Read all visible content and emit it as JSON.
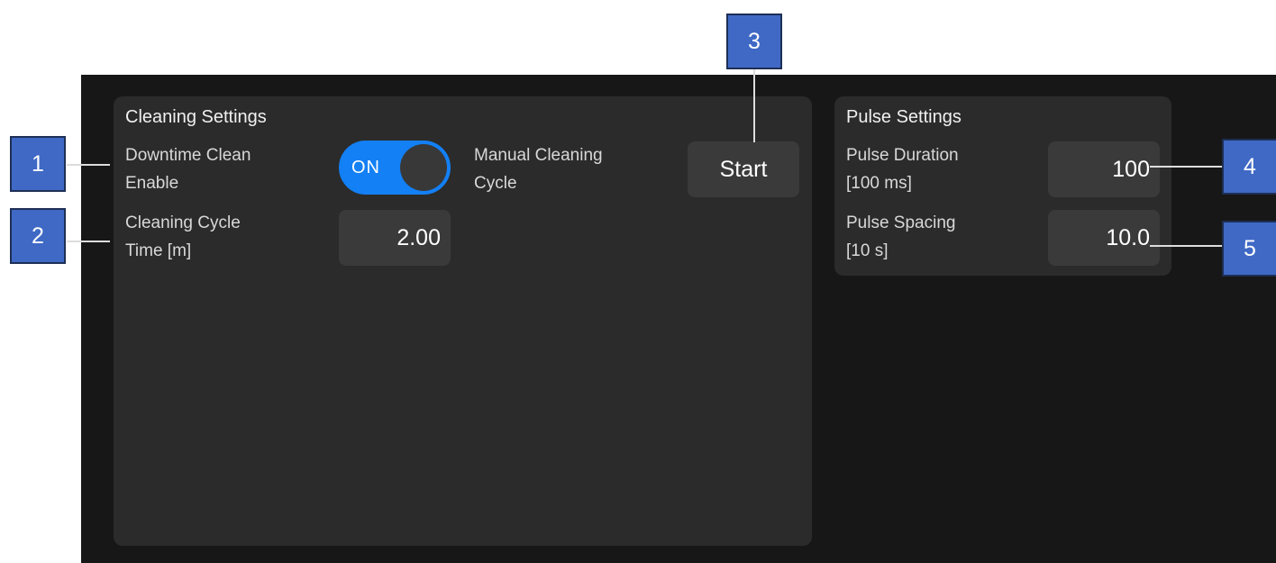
{
  "cleaning_settings": {
    "title": "Cleaning Settings",
    "downtime_clean": {
      "label_line1": "Downtime Clean",
      "label_line2": "Enable",
      "toggle_state": "ON"
    },
    "manual_cleaning": {
      "label_line1": "Manual Cleaning",
      "label_line2": "Cycle",
      "button_label": "Start"
    },
    "cycle_time": {
      "label_line1": "Cleaning Cycle",
      "label_line2": "Time [m]",
      "value": "2.00"
    }
  },
  "pulse_settings": {
    "title": "Pulse Settings",
    "pulse_duration": {
      "label_line1": "Pulse Duration",
      "label_line2": "[100 ms]",
      "value": "100"
    },
    "pulse_spacing": {
      "label_line1": "Pulse Spacing",
      "label_line2": "[10 s]",
      "value": "10.0"
    }
  },
  "callouts": [
    "1",
    "2",
    "3",
    "4",
    "5"
  ],
  "colors": {
    "background": "#171717",
    "panel": "#2b2b2b",
    "field": "#3a3a3a",
    "toggle_on": "#1380f5",
    "callout_fill": "#3f69c5"
  }
}
